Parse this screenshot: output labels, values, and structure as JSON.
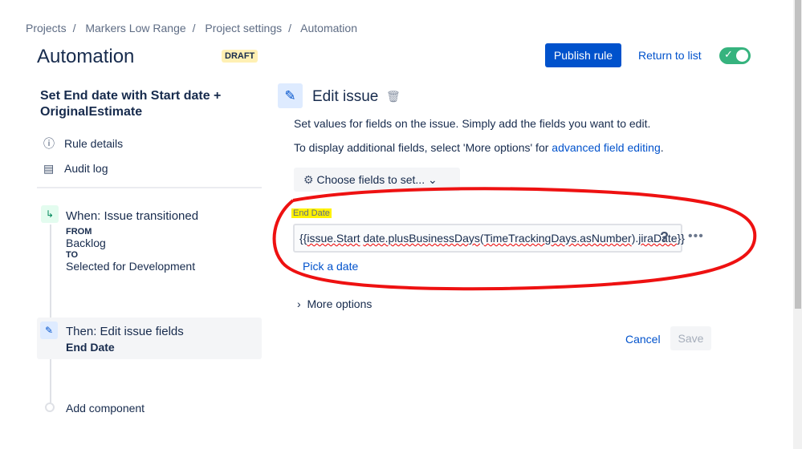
{
  "breadcrumb": [
    "Projects",
    "/",
    "Markers Low Range",
    "/",
    "Project settings",
    "/",
    "Automation"
  ],
  "header": {
    "title": "Automation",
    "badge": "DRAFT",
    "publish": "Publish rule",
    "return": "Return to list",
    "toggle_icon": "✓"
  },
  "sidebar": {
    "rule_name": "Set End date with Start date + OriginalEstimate",
    "rule_details": "Rule details",
    "audit_log": "Audit log",
    "trigger": {
      "title": "When: Issue transitioned",
      "from_label": "FROM",
      "from": "Backlog",
      "to_label": "TO",
      "to": "Selected for Development"
    },
    "action": {
      "title": "Then: Edit issue fields",
      "field": "End Date"
    },
    "add": "Add component"
  },
  "main": {
    "title": "Edit issue",
    "desc1": "Set values for fields on the issue. Simply add the fields you want to edit.",
    "desc2": "To display additional fields, select 'More options' for ",
    "desc2_link": "advanced field editing",
    "desc2_end": ".",
    "choose": "Choose fields to set...",
    "field_label": "End Date",
    "value_parts": [
      "{{",
      "issue.Start",
      " ",
      "date.plusBusinessDays",
      "(",
      "TimeTrackingDays.asNumber",
      ").",
      "jiraDate",
      "}}"
    ],
    "help": "?",
    "more_icon": "•••",
    "pick": "Pick a date",
    "more_options": "More options",
    "cancel": "Cancel",
    "save": "Save"
  }
}
